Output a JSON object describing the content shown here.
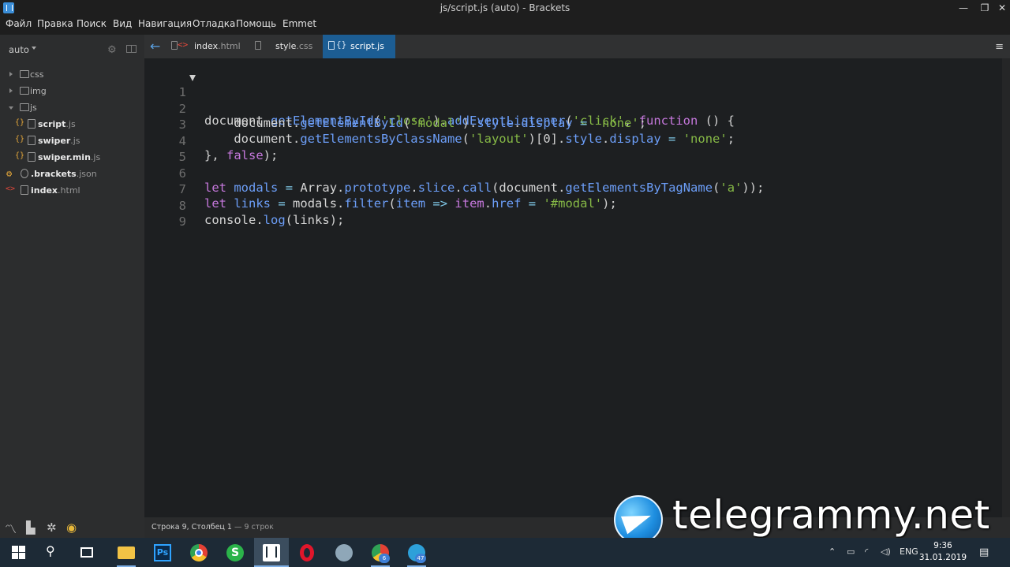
{
  "window": {
    "title": "js/script.js (auto) - Brackets",
    "minimize": "—",
    "maximize": "❐",
    "close": "✕"
  },
  "menu": [
    "Файл",
    "Правка",
    "Поиск",
    "Вид",
    "Навигация",
    "Отладка",
    "Помощь",
    "Emmet"
  ],
  "sidebar": {
    "project": "auto",
    "tree": [
      {
        "type": "folder",
        "name": "css",
        "open": false
      },
      {
        "type": "folder",
        "name": "img",
        "open": false
      },
      {
        "type": "folder",
        "name": "js",
        "open": true
      },
      {
        "type": "file",
        "badge": "{}",
        "base": "script",
        "ext": ".js"
      },
      {
        "type": "file",
        "badge": "{}",
        "base": "swiper",
        "ext": ".js"
      },
      {
        "type": "file",
        "badge": "{}",
        "base": "swiper.min",
        "ext": ".js"
      },
      {
        "type": "file",
        "badge": "⚙",
        "base": ".brackets",
        "ext": ".json"
      },
      {
        "type": "file",
        "badge": "<>",
        "base": "index",
        "ext": ".html"
      }
    ]
  },
  "tabs": [
    {
      "badge": "<>",
      "base": "index",
      "ext": ".html",
      "active": false
    },
    {
      "badge": "",
      "base": "style",
      "ext": ".css",
      "active": false
    },
    {
      "badge": "{}",
      "base": "script",
      "ext": ".js",
      "active": true
    }
  ],
  "editor": {
    "line_numbers": [
      "1",
      "2",
      "3",
      "4",
      "5",
      "6",
      "7",
      "8",
      "9"
    ]
  },
  "status": {
    "position": "Строка 9, Столбец 1",
    "lines": " — 9 строк"
  },
  "watermark": "telegrammy.net",
  "taskbar": {
    "ps_label": "Ps",
    "s_label": "S",
    "chrome_badge": "6",
    "tg_badge": "47",
    "lang": "ENG",
    "time": "9:36",
    "date": "31.01.2019"
  },
  "colors": {
    "accent": "#1c5d93",
    "string": "#86b946",
    "method": "#6c9ef8",
    "keyword": "#c678dd",
    "operator": "#80c8e8"
  }
}
